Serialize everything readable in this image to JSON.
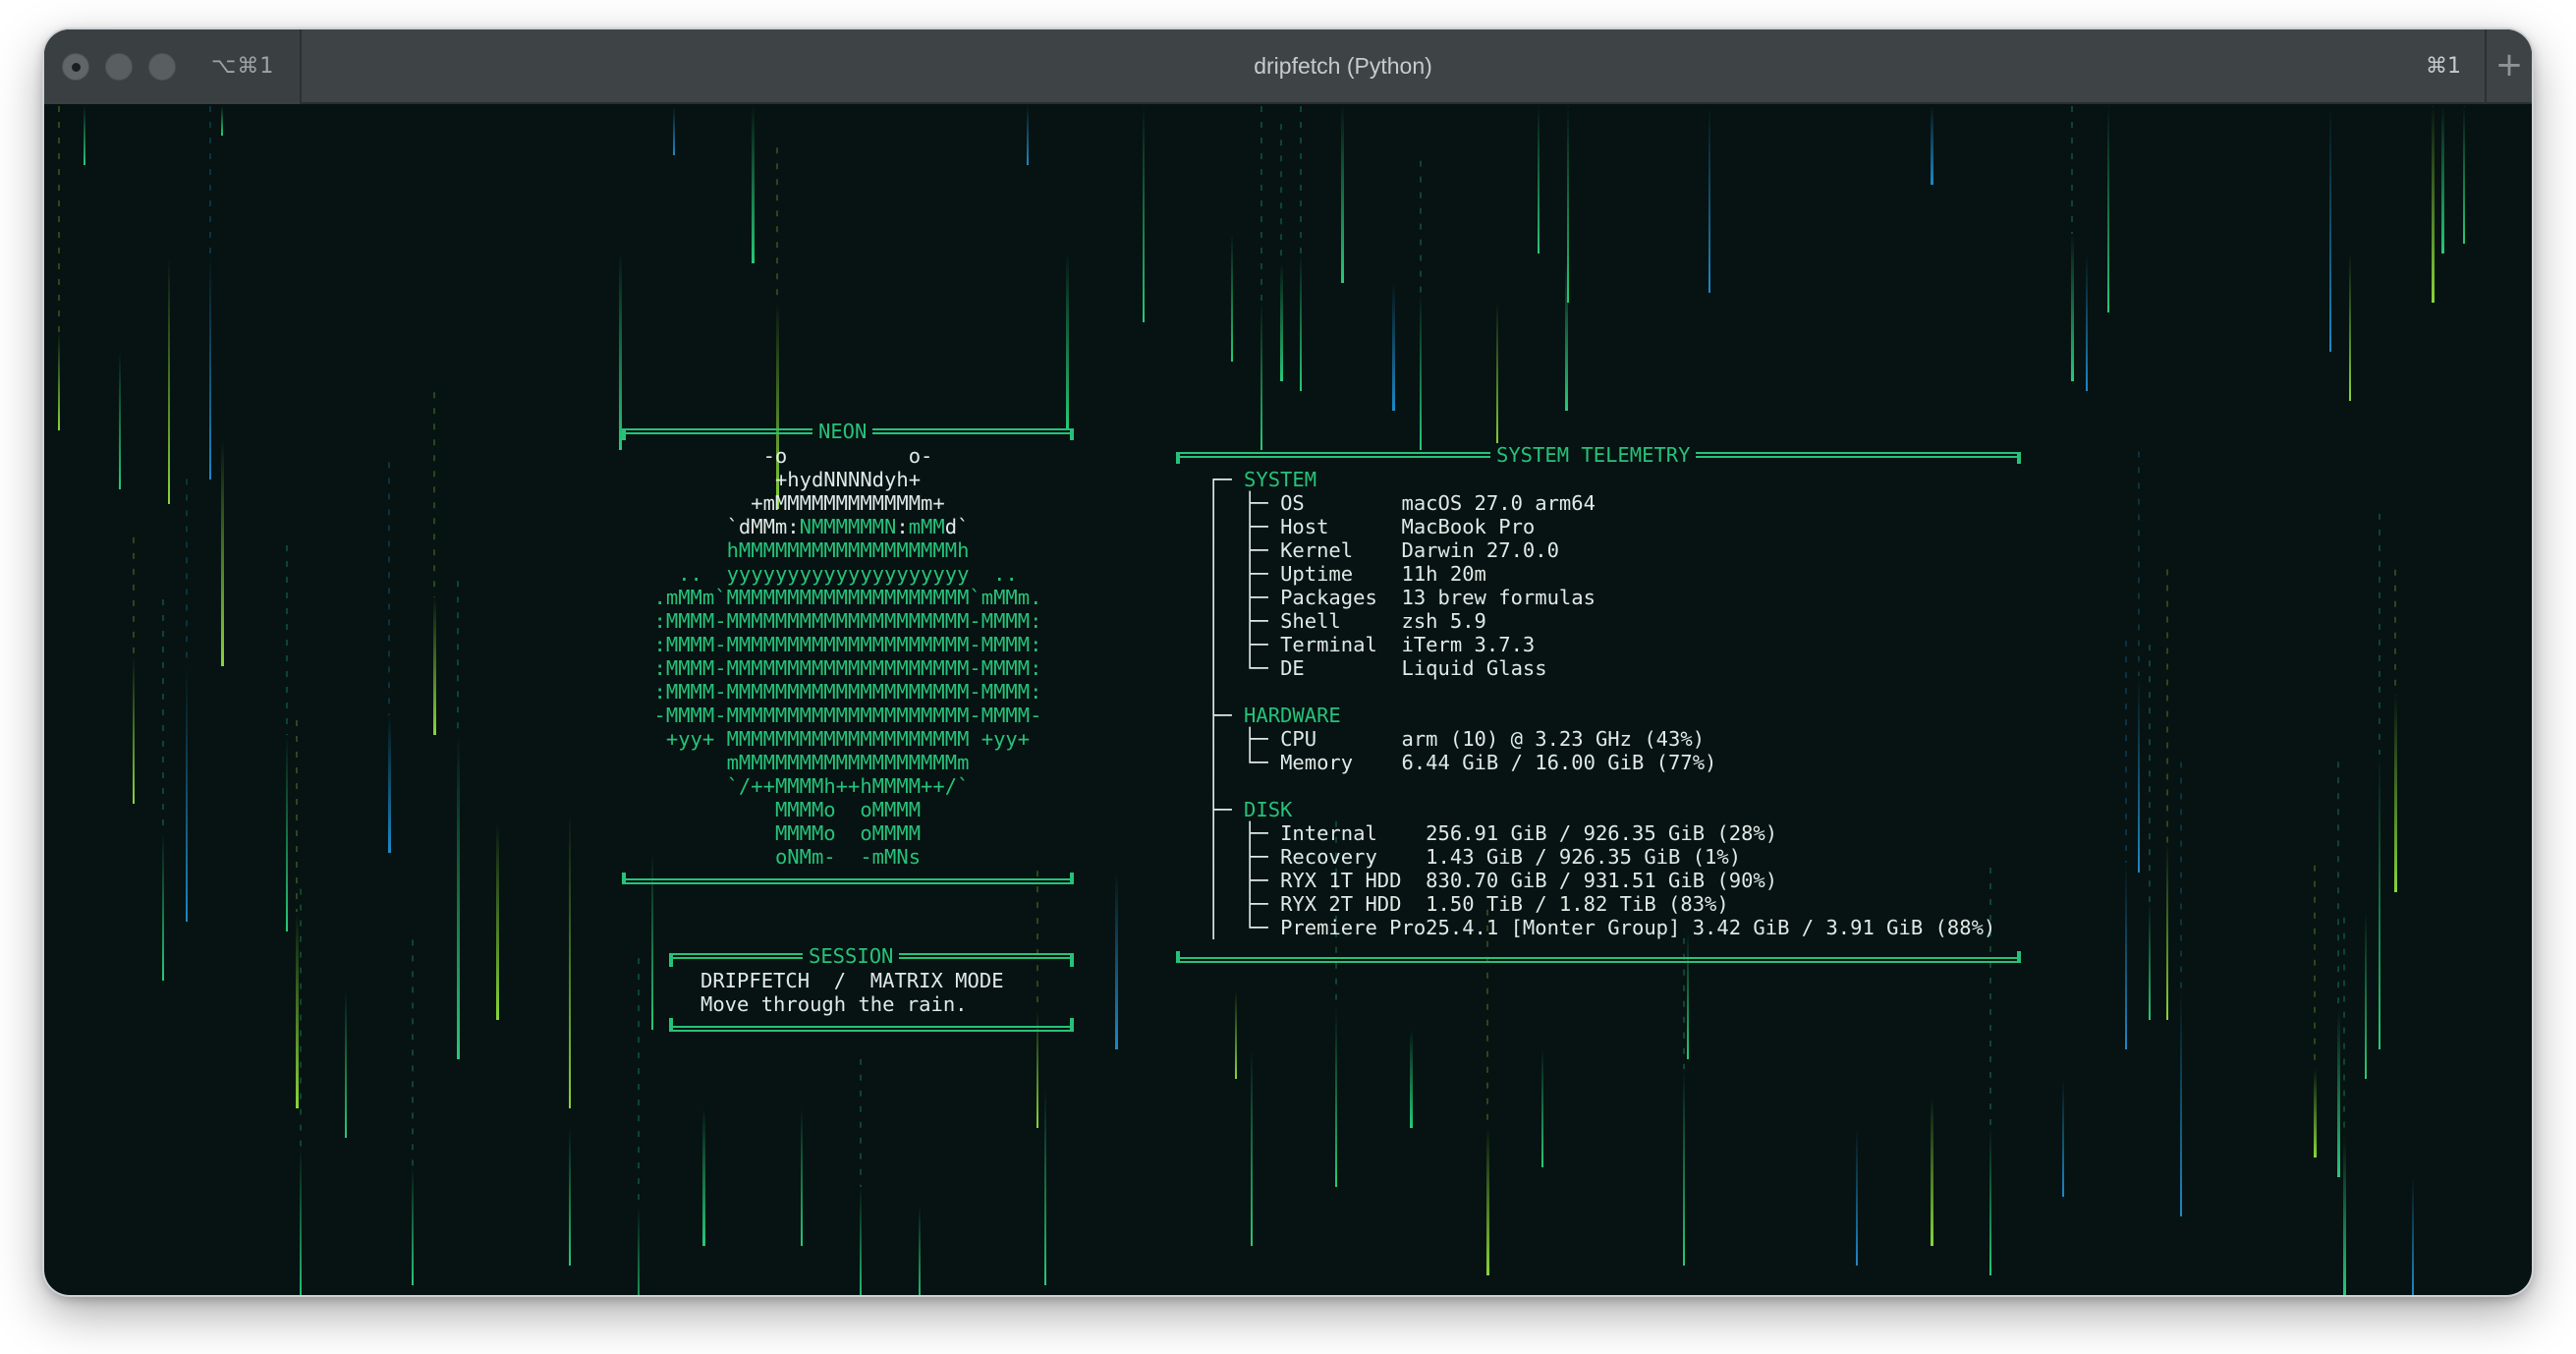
{
  "window": {
    "title": "dripfetch (Python)",
    "tab_shortcut": "⌥⌘1",
    "right_shortcut": "⌘1",
    "new_tab_icon": "+"
  },
  "neon_panel": {
    "title": "NEON",
    "logo": [
      {
        "text": "-o          o-",
        "accent": null
      },
      {
        "text": "+hydNNNNdyh+",
        "accent": null
      },
      {
        "text": "+mMMMMMMMMMMMMm+",
        "accent": null
      },
      {
        "text": "`dMMm:NMMMMMMN:mMMd`",
        "accent": [
          6,
          14
        ],
        "accent2": [
          15,
          18
        ]
      },
      {
        "text": "hMMMMMMMMMMMMMMMMMMh",
        "accent": "all"
      },
      {
        "text": "..  yyyyyyyyyyyyyyyyyyyy  ..",
        "accent": "all"
      },
      {
        "text": ".mMMm`MMMMMMMMMMMMMMMMMMMM`mMMm.",
        "accent": "all"
      },
      {
        "text": ":MMMM-MMMMMMMMMMMMMMMMMMMM-MMMM:",
        "accent": "all"
      },
      {
        "text": ":MMMM-MMMMMMMMMMMMMMMMMMMM-MMMM:",
        "accent": "all"
      },
      {
        "text": ":MMMM-MMMMMMMMMMMMMMMMMMMM-MMMM:",
        "accent": "all"
      },
      {
        "text": ":MMMM-MMMMMMMMMMMMMMMMMMMM-MMMM:",
        "accent": "all"
      },
      {
        "text": "-MMMM-MMMMMMMMMMMMMMMMMMMM-MMMM-",
        "accent": "all"
      },
      {
        "text": "+yy+ MMMMMMMMMMMMMMMMMMMM +yy+",
        "accent": "all"
      },
      {
        "text": "mMMMMMMMMMMMMMMMMMMm",
        "accent": "all"
      },
      {
        "text": "`/++MMMMh++hMMMM++/`",
        "accent": "all"
      },
      {
        "text": "MMMMo  oMMMM",
        "accent": "all"
      },
      {
        "text": "MMMMo  oMMMM",
        "accent": "all"
      },
      {
        "text": "oNMm-  -mMNs",
        "accent": "all"
      }
    ]
  },
  "session_panel": {
    "title": "SESSION",
    "line1": "DRIPFETCH  /  MATRIX MODE",
    "line2": "Move through the rain."
  },
  "telemetry_panel": {
    "title": "SYSTEM TELEMETRY",
    "sections": [
      {
        "name": "SYSTEM",
        "rows": [
          {
            "key": "OS",
            "value": "macOS 27.0 arm64"
          },
          {
            "key": "Host",
            "value": "MacBook Pro"
          },
          {
            "key": "Kernel",
            "value": "Darwin 27.0.0"
          },
          {
            "key": "Uptime",
            "value": "11h 20m"
          },
          {
            "key": "Packages",
            "value": "13 brew formulas"
          },
          {
            "key": "Shell",
            "value": "zsh 5.9"
          },
          {
            "key": "Terminal",
            "value": "iTerm 3.7.3"
          },
          {
            "key": "DE",
            "value": "Liquid Glass"
          }
        ]
      },
      {
        "name": "HARDWARE",
        "rows": [
          {
            "key": "CPU",
            "value": "arm (10) @ 3.23 GHz (43%)"
          },
          {
            "key": "Memory",
            "value": "6.44 GiB / 16.00 GiB (77%)"
          }
        ]
      },
      {
        "name": "DISK",
        "rows": [
          {
            "key": "Internal",
            "value": "256.91 GiB / 926.35 GiB (28%)"
          },
          {
            "key": "Recovery",
            "value": "1.43 GiB / 926.35 GiB (1%)"
          },
          {
            "key": "RYX 1T HDD",
            "value": "830.70 GiB / 931.51 GiB (90%)"
          },
          {
            "key": "RYX 2T HDD",
            "value": "1.50 TiB / 1.82 TiB (83%)"
          },
          {
            "key": "Premiere Pro",
            "value": "25.4.1 [Monter Group] 3.42 GiB / 3.91 GiB (88%)"
          }
        ]
      }
    ]
  },
  "colors": {
    "background": "#061312",
    "accent_green": "#27c27a",
    "text": "#dfe9e6",
    "rain_blue": "#1e8fd0",
    "rain_green": "#28d47e",
    "rain_lime": "#8fe03a"
  }
}
